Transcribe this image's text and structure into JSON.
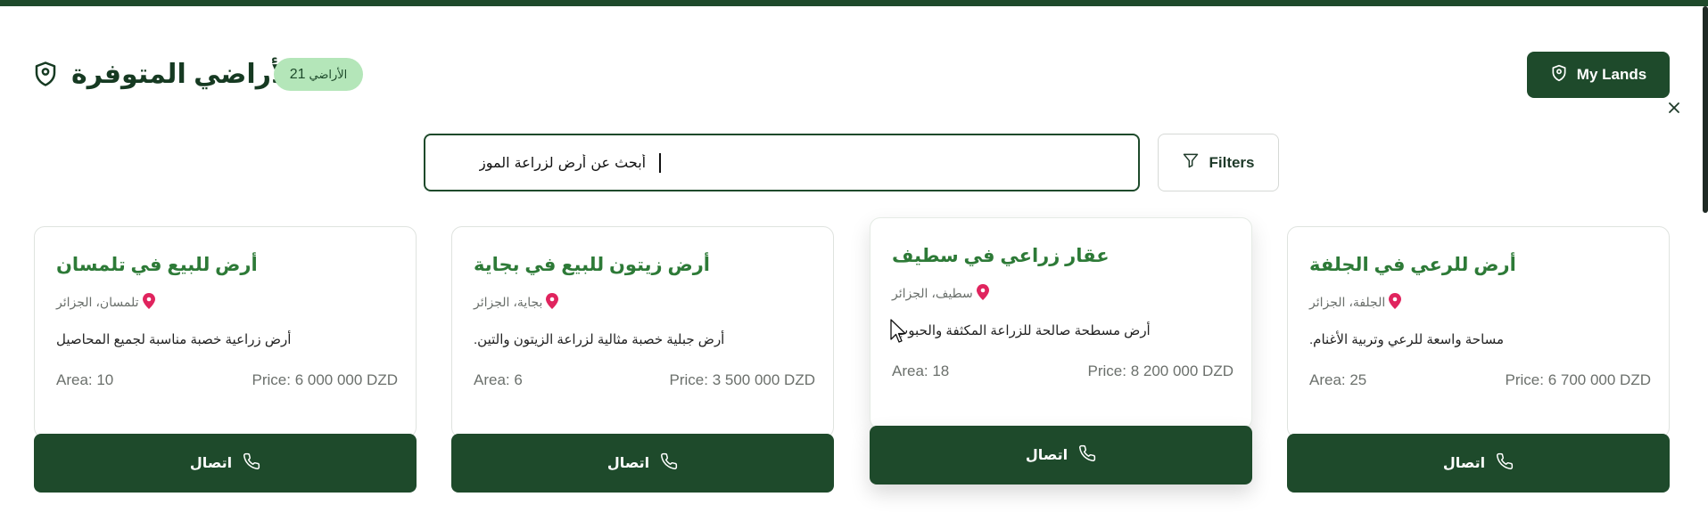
{
  "header": {
    "title": "الأراضي المتوفرة",
    "count_badge": {
      "number": "21",
      "label": "الأراضي"
    },
    "my_lands_label": "My Lands"
  },
  "search": {
    "value": "أبحث عن أرض لزراعة الموز",
    "filters_label": "Filters"
  },
  "cards": [
    {
      "title": "أرض للرعي في الجلفة",
      "location": "الجلفة، الجزائر",
      "description": "مساحة واسعة للرعي وتربية الأغنام.",
      "area": "Area: 25",
      "price": "Price: 6 700 000 DZD",
      "contact_label": "اتصال"
    },
    {
      "title": "عقار زراعي في سطيف",
      "location": "سطيف، الجزائر",
      "description": "أرض مسطحة صالحة للزراعة المكثفة والحبوب.",
      "area": "Area: 18",
      "price": "Price: 8 200 000 DZD",
      "contact_label": "اتصال"
    },
    {
      "title": "أرض زيتون للبيع في بجاية",
      "location": "بجاية، الجزائر",
      "description": "أرض جبلية خصبة مثالية لزراعة الزيتون والتين.",
      "area": "Area: 6",
      "price": "Price: 3 500 000 DZD",
      "contact_label": "اتصال"
    },
    {
      "title": "أرض للبيع في تلمسان",
      "location": "تلمسان، الجزائر",
      "description": "أرض زراعية خصبة مناسبة لجميع المحاصيل",
      "area": "Area: 10",
      "price": "Price: 6 000 000 DZD",
      "contact_label": "اتصال"
    }
  ],
  "icons": {
    "title": "map-pin-shield-icon",
    "my_lands": "map-pin-shield-icon",
    "close": "close-icon",
    "filters": "filter-icon",
    "location": "location-pin-icon",
    "contact": "phone-icon"
  },
  "colors": {
    "primary": "#1e4a2b",
    "card_title": "#2d7a37",
    "badge_bg": "#b4e6b9",
    "pin": "#e0245e"
  }
}
